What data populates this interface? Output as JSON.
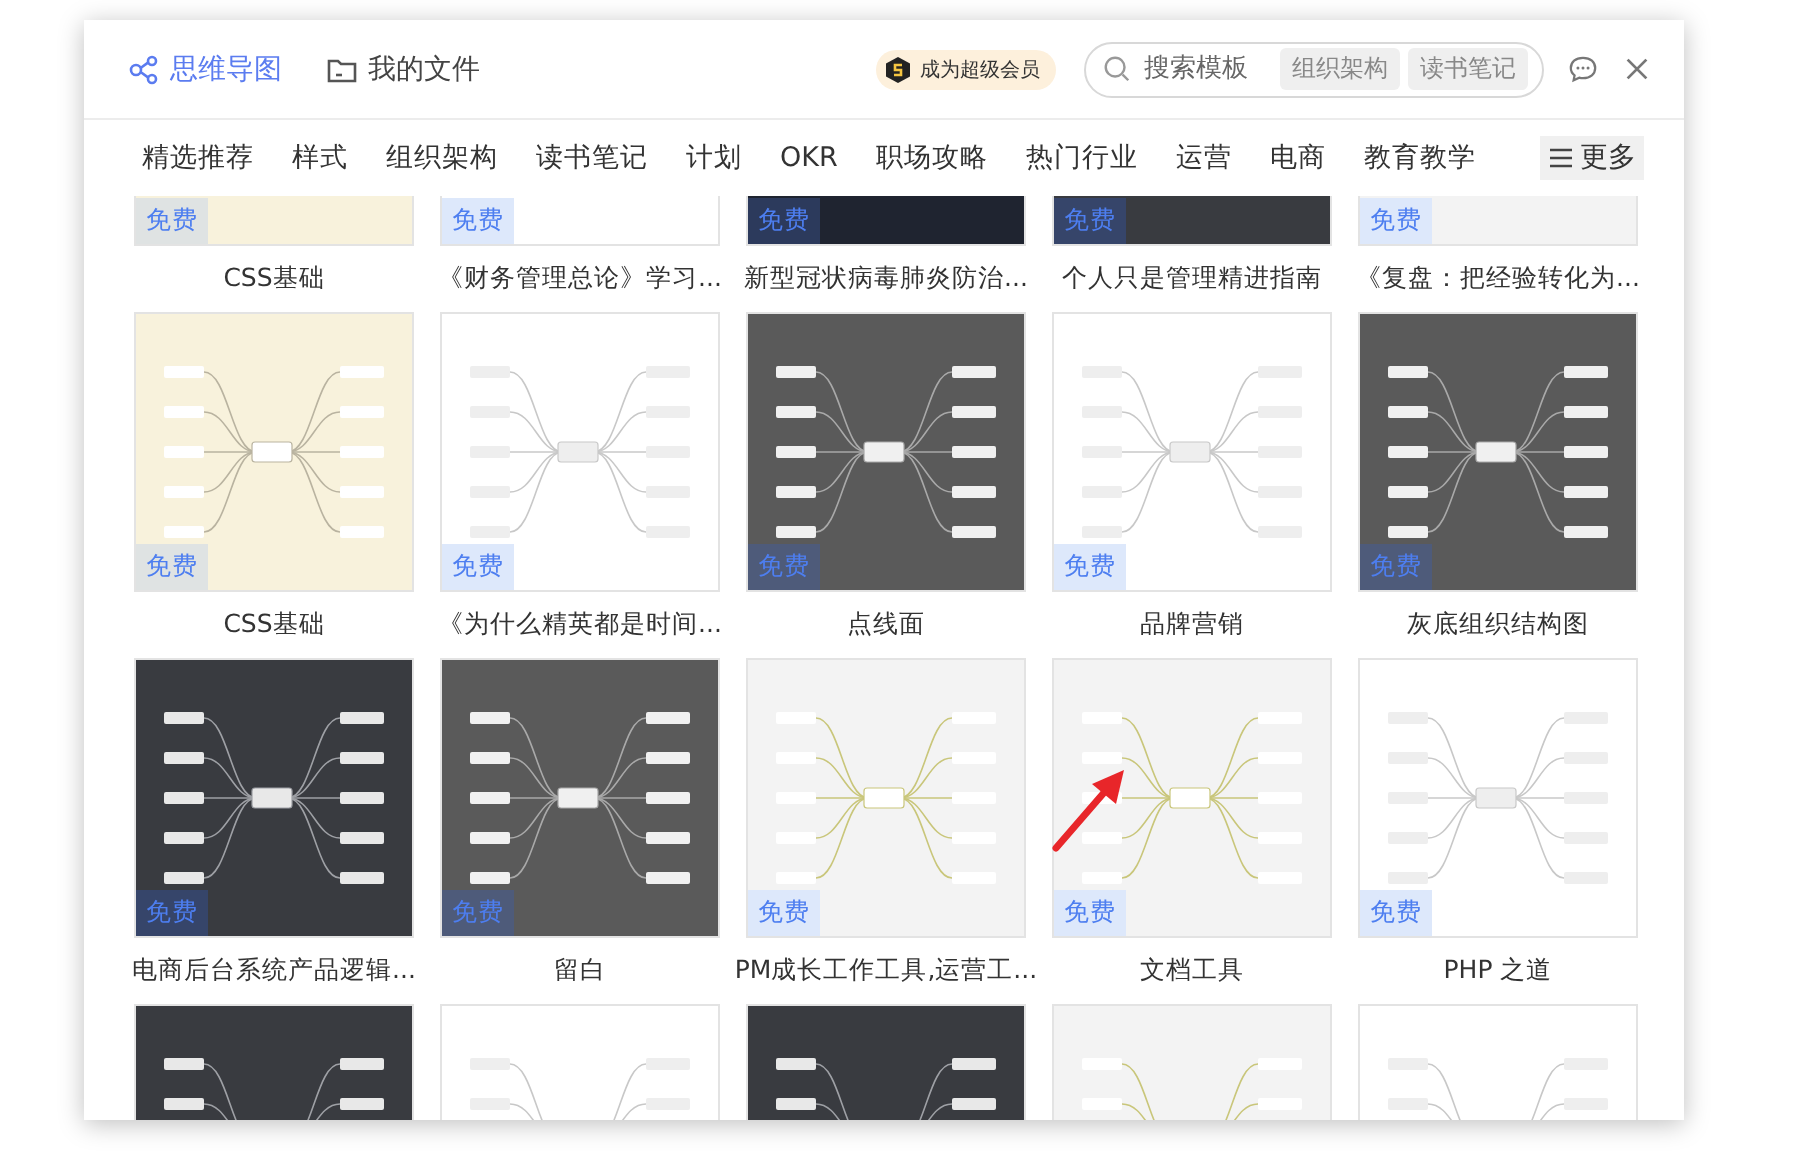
{
  "header": {
    "tabs": [
      {
        "label": "思维导图",
        "selected": true
      },
      {
        "label": "我的文件",
        "selected": false
      }
    ],
    "vip_badge": "成为超级会员",
    "search": {
      "placeholder": "搜索模板",
      "tags": [
        "组织架构",
        "读书笔记"
      ]
    }
  },
  "categories": [
    "精选推荐",
    "样式",
    "组织架构",
    "读书笔记",
    "计划",
    "OKR",
    "职场攻略",
    "热门行业",
    "运营",
    "电商",
    "教育教学"
  ],
  "more_button": "更多",
  "templates": [
    {
      "title": "CSS基础",
      "badge": "免费",
      "kind": "cream"
    },
    {
      "title": "《财务管理总论》学习...",
      "badge": "免费",
      "kind": "white"
    },
    {
      "title": "新型冠状病毒肺炎防治...",
      "badge": "免费",
      "kind": "navy"
    },
    {
      "title": "个人只是管理精进指南",
      "badge": "免费",
      "kind": "dark"
    },
    {
      "title": "《复盘：把经验转化为...",
      "badge": "免费",
      "kind": "light"
    },
    {
      "title": "CSS基础",
      "badge": "免费",
      "kind": "cream"
    },
    {
      "title": "《为什么精英都是时间...",
      "badge": "免费",
      "kind": "white"
    },
    {
      "title": "点线面",
      "badge": "免费",
      "kind": "gray"
    },
    {
      "title": "品牌营销",
      "badge": "免费",
      "kind": "white"
    },
    {
      "title": "灰底组织结构图",
      "badge": "免费",
      "kind": "gray"
    },
    {
      "title": "电商后台系统产品逻辑...",
      "badge": "免费",
      "kind": "dark"
    },
    {
      "title": "留白",
      "badge": "免费",
      "kind": "gray"
    },
    {
      "title": "PM成长工作工具,运营工...",
      "badge": "免费",
      "kind": "light"
    },
    {
      "title": "文档工具",
      "badge": "免费",
      "kind": "light"
    },
    {
      "title": "PHP 之道",
      "badge": "免费",
      "kind": "white"
    },
    {
      "kind": "dark"
    },
    {
      "kind": "white"
    },
    {
      "kind": "dark"
    },
    {
      "kind": "light"
    },
    {
      "kind": "white"
    }
  ]
}
